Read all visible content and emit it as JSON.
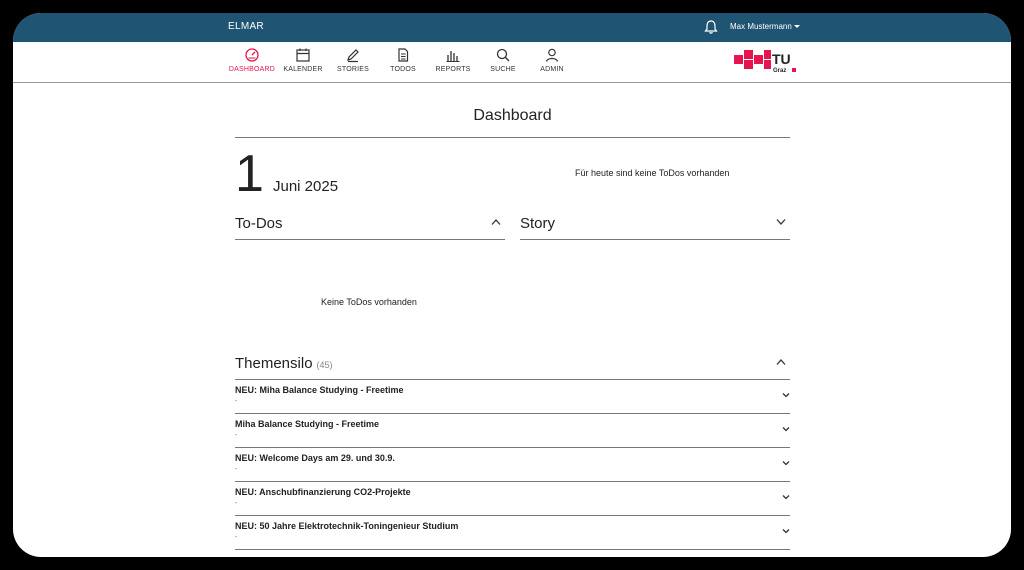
{
  "app": {
    "title": "ELMAR"
  },
  "user": {
    "name": "Max Mustermann"
  },
  "nav": {
    "items": [
      {
        "label": "DASHBOARD",
        "icon": "speedometer-icon",
        "active": true
      },
      {
        "label": "KALENDER",
        "icon": "calendar-icon"
      },
      {
        "label": "STORIES",
        "icon": "pencil-icon"
      },
      {
        "label": "TODOS",
        "icon": "document-icon"
      },
      {
        "label": "REPORTS",
        "icon": "bar-chart-icon"
      },
      {
        "label": "SUCHE",
        "icon": "search-icon"
      },
      {
        "label": "ADMIN",
        "icon": "user-icon"
      }
    ]
  },
  "logo": {
    "text": "TU",
    "subtext": "Graz",
    "color": "#e5154f"
  },
  "page": {
    "title": "Dashboard",
    "date_day": "1",
    "date_month_year": "Juni  2025",
    "today_todos_note": "Für heute sind keine ToDos vorhanden"
  },
  "panels": {
    "todos": {
      "title": "To-Dos",
      "empty": "Keine ToDos vorhanden"
    },
    "story": {
      "title": "Story"
    }
  },
  "themensilo": {
    "title": "Themensilo",
    "count": "(45)",
    "items": [
      {
        "title": "NEU: Miha Balance Studying - Freetime",
        "sub": "-"
      },
      {
        "title": "Miha Balance Studying - Freetime",
        "sub": "-"
      },
      {
        "title": "NEU: Welcome Days am 29. und 30.9.",
        "sub": "-"
      },
      {
        "title": "NEU: Anschubfinanzierung CO2-Projekte",
        "sub": "-"
      },
      {
        "title": "NEU: 50 Jahre Elektrotechnik-Toningenieur Studium",
        "sub": "-"
      }
    ]
  },
  "colors": {
    "topbar": "#1f5473",
    "accent": "#e5154f"
  }
}
